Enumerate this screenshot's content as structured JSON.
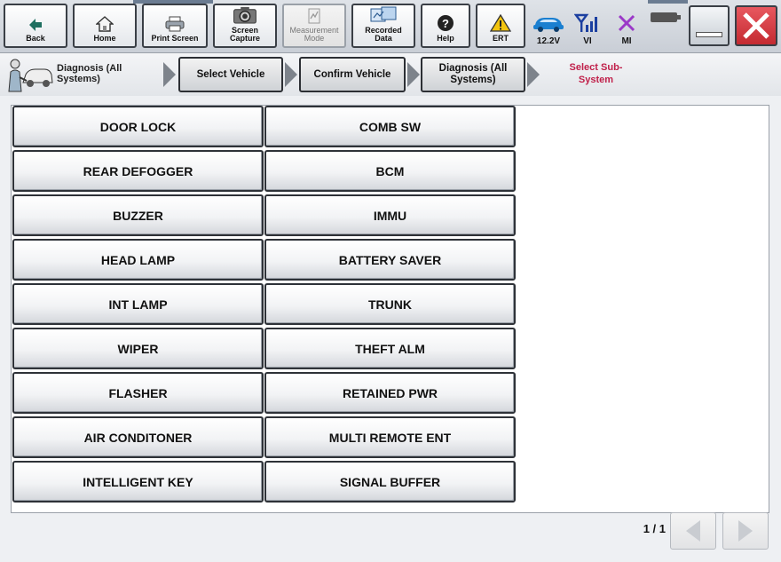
{
  "toolbar": {
    "back": "Back",
    "home": "Home",
    "print_screen": "Print Screen",
    "screen_capture": "Screen Capture",
    "measurement_mode": "Measurement Mode",
    "recorded_data": "Recorded Data",
    "help": "Help",
    "ert": "ERT",
    "voltage": "12.2V",
    "vi": "VI",
    "mi": "MI"
  },
  "breadcrumb": {
    "root": "Diagnosis (All Systems)",
    "step1": "Select Vehicle",
    "step2": "Confirm Vehicle",
    "step3": "Diagnosis (All Systems)",
    "current": "Select Sub-System"
  },
  "subsystems": {
    "left": [
      "DOOR LOCK",
      "REAR DEFOGGER",
      "BUZZER",
      "HEAD LAMP",
      "INT LAMP",
      "WIPER",
      "FLASHER",
      "AIR CONDITONER",
      "INTELLIGENT KEY"
    ],
    "right": [
      "COMB SW",
      "BCM",
      "IMMU",
      "BATTERY SAVER",
      "TRUNK",
      "THEFT ALM",
      "RETAINED PWR",
      "MULTI REMOTE ENT",
      "SIGNAL BUFFER"
    ]
  },
  "pagination": {
    "indicator": "1 / 1"
  },
  "colors": {
    "current_step": "#c0204a",
    "car_icon": "#1a7fd0",
    "signal_icon": "#1b3fa0",
    "mi_icon": "#9b39c8",
    "close_button": "#d9363e"
  }
}
